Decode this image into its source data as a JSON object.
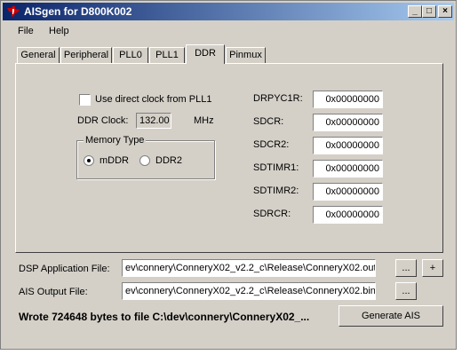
{
  "window": {
    "title": "AISgen for D800K002",
    "minimize": "_",
    "maximize": "□",
    "close": "×"
  },
  "menu": {
    "items": [
      "File",
      "Help"
    ]
  },
  "tabs": [
    {
      "label": "General"
    },
    {
      "label": "Peripheral"
    },
    {
      "label": "PLL0"
    },
    {
      "label": "PLL1"
    },
    {
      "label": "DDR",
      "active": true
    },
    {
      "label": "Pinmux"
    }
  ],
  "ddr": {
    "use_direct_clock_label": "Use direct clock from PLL1",
    "use_direct_clock_checked": false,
    "clock_label": "DDR Clock:",
    "clock_value": "132.00",
    "clock_unit": "MHz",
    "memory_type_label": "Memory Type",
    "memory_types": [
      {
        "label": "mDDR",
        "selected": true
      },
      {
        "label": "DDR2",
        "selected": false
      }
    ],
    "registers": [
      {
        "name": "DRPYC1R:",
        "value": "0x00000000"
      },
      {
        "name": "SDCR:",
        "value": "0x00000000"
      },
      {
        "name": "SDCR2:",
        "value": "0x00000000"
      },
      {
        "name": "SDTIMR1:",
        "value": "0x00000000"
      },
      {
        "name": "SDTIMR2:",
        "value": "0x00000000"
      },
      {
        "name": "SDRCR:",
        "value": "0x00000000"
      }
    ]
  },
  "files": {
    "dsp_label": "DSP Application File:",
    "dsp_value": "ev\\connery\\ConneryX02_v2.2_c\\Release\\ConneryX02.out",
    "ais_label": "AIS Output File:",
    "ais_value": "ev\\connery\\ConneryX02_v2.2_c\\Release\\ConneryX02.bin",
    "browse_label": "...",
    "add_label": "+"
  },
  "status": {
    "message": "Wrote 724648 bytes to file C:\\dev\\connery\\ConneryX02_..."
  },
  "actions": {
    "generate_label": "Generate AIS"
  },
  "colors": {
    "face": "#d4d0c8",
    "title_start": "#0a246a",
    "title_end": "#a6caf0",
    "logo": "#cc0000"
  }
}
